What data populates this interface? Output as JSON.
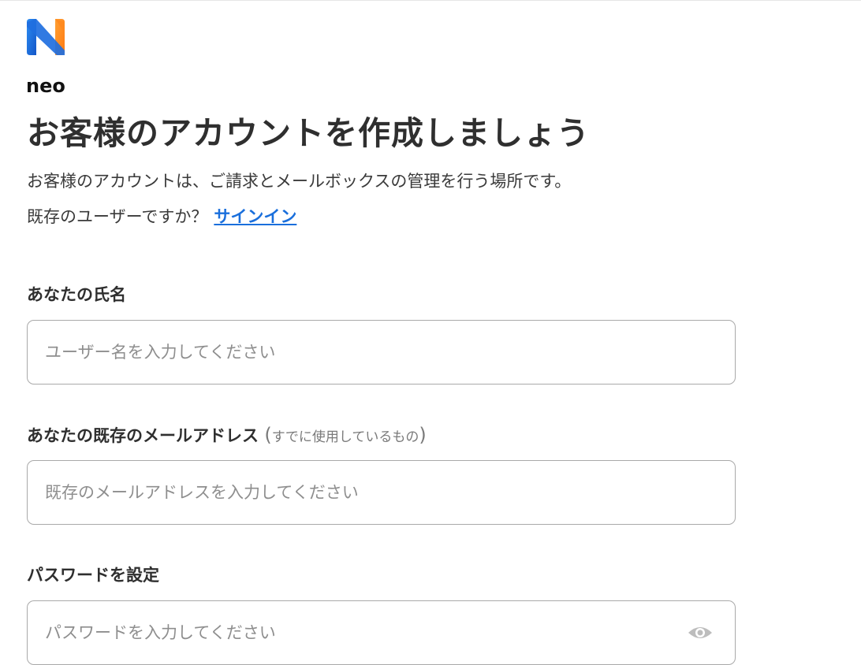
{
  "brand": {
    "name": "neo"
  },
  "header": {
    "title": "お客様のアカウントを作成しましょう",
    "subtitle": "お客様のアカウントは、ご請求とメールボックスの管理を行う場所です。",
    "existing_user_prompt": "既存のユーザーですか？",
    "signin_link": "サインイン"
  },
  "form": {
    "name_label": "あなたの氏名",
    "name_placeholder": "ユーザー名を入力してください",
    "email_label": "あなたの既存のメールアドレス",
    "email_note_open": "(",
    "email_note": "すでに使用しているもの",
    "email_note_close": ")",
    "email_placeholder": "既存のメールアドレスを入力してください",
    "password_label": "パスワードを設定",
    "password_placeholder": "パスワードを入力してください"
  },
  "icons": {
    "password_toggle": "eye-icon",
    "logo": "neo-logo-icon"
  },
  "colors": {
    "link": "#1a6fdc",
    "logo_blue": "#1f6fe0",
    "logo_orange": "#ff8a1f"
  }
}
